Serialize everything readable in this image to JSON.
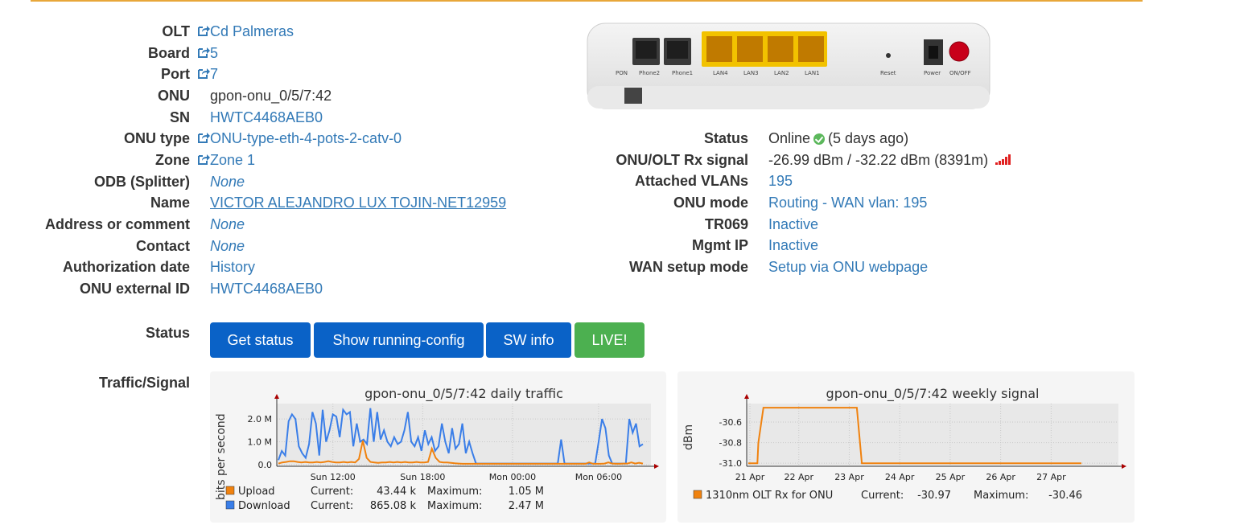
{
  "onu_details": [
    {
      "label": "OLT",
      "value": "Cd Palmeras",
      "link_icon": true,
      "style": "link"
    },
    {
      "label": "Board",
      "value": "5",
      "link_icon": true,
      "style": "link"
    },
    {
      "label": "Port",
      "value": "7",
      "link_icon": true,
      "style": "link"
    },
    {
      "label": "ONU",
      "value": "gpon-onu_0/5/7:42",
      "link_icon": false,
      "style": "plain"
    },
    {
      "label": "SN",
      "value": "HWTC4468AEB0",
      "link_icon": false,
      "style": "link"
    },
    {
      "label": "ONU type",
      "value": "ONU-type-eth-4-pots-2-catv-0",
      "link_icon": true,
      "style": "link"
    },
    {
      "label": "Zone",
      "value": "Zone 1",
      "link_icon": true,
      "style": "link"
    },
    {
      "label": "ODB (Splitter)",
      "value": "None",
      "link_icon": false,
      "style": "italic"
    },
    {
      "label": "Name",
      "value": "VICTOR ALEJANDRO LUX TOJIN-NET12959",
      "link_icon": false,
      "style": "underline"
    },
    {
      "label": "Address or comment",
      "value": "None",
      "link_icon": false,
      "style": "italic"
    },
    {
      "label": "Contact",
      "value": "None",
      "link_icon": false,
      "style": "italic"
    },
    {
      "label": "Authorization date",
      "value": "History",
      "link_icon": false,
      "style": "link"
    },
    {
      "label": "ONU external ID",
      "value": "HWTC4468AEB0",
      "link_icon": false,
      "style": "link"
    }
  ],
  "device_image": {
    "ports": [
      "PON",
      "Phone2",
      "Phone1",
      "LAN4",
      "LAN3",
      "LAN2",
      "LAN1",
      "Reset",
      "Power",
      "ON/OFF"
    ]
  },
  "onu_status": {
    "status_label": "Status",
    "status_value": "Online",
    "status_suffix": "(5 days ago)",
    "rx_label": "ONU/OLT Rx signal",
    "rx_value": "-26.99 dBm / -32.22 dBm (8391m)",
    "vlans_label": "Attached VLANs",
    "vlans_value": "195",
    "mode_label": "ONU mode",
    "mode_value": "Routing - WAN vlan: 195",
    "tr069_label": "TR069",
    "tr069_value": "Inactive",
    "mgmt_label": "Mgmt IP",
    "mgmt_value": "Inactive",
    "wan_label": "WAN setup mode",
    "wan_value": "Setup via ONU webpage"
  },
  "actions": {
    "section_label": "Status",
    "get_status": "Get status",
    "show_running_config": "Show running-config",
    "sw_info": "SW info",
    "live": "LIVE!"
  },
  "graphs": {
    "section_label": "Traffic/Signal"
  },
  "colors": {
    "link": "#337ab7",
    "primary_button": "#0a62c7",
    "live_button": "#4cb050",
    "upload": "#f0820f",
    "download": "#3a7ee8",
    "accent_line": "#e8a73a"
  },
  "chart_data": [
    {
      "type": "line",
      "title": "gpon-onu_0/5/7:42 daily traffic",
      "ylabel": "bits per second",
      "yticks": [
        "2.0 M",
        "1.0 M",
        "0.0"
      ],
      "xticks": [
        "Sun 12:00",
        "Sun 18:00",
        "Mon 00:00",
        "Mon 06:00"
      ],
      "ylim": [
        0,
        2.6
      ],
      "grid": true,
      "series": [
        {
          "name": "Upload",
          "color": "#f0820f",
          "values": [
            0.05,
            0.1,
            0.12,
            0.15,
            0.15,
            0.12,
            0.1,
            0.12,
            0.1,
            0.1,
            0.12,
            0.1,
            0.12,
            0.15,
            0.12,
            0.1,
            0.1,
            0.12,
            0.1,
            0.12,
            0.1,
            0.25,
            1.05,
            0.3,
            0.12,
            0.1,
            0.08,
            0.1,
            0.1,
            0.12,
            0.1,
            0.12,
            0.1,
            0.12,
            0.1,
            0.1,
            0.12,
            0.1,
            0.1,
            0.12,
            0.7,
            0.3,
            0.12,
            0.1,
            0.1,
            0.08,
            0.06,
            0.05,
            0.04,
            0.04,
            0.04,
            0.04,
            0.04,
            0.04,
            0.04,
            0.04,
            0.04,
            0.04,
            0.04,
            0.04,
            0.04,
            0.04,
            0.04,
            0.04,
            0.04,
            0.04,
            0.04,
            0.04,
            0.04,
            0.04,
            0.04,
            0.04,
            0.04,
            0.04,
            0.04,
            0.04,
            0.04,
            0.04,
            0.04,
            0.04,
            0.04,
            0.1,
            0.04,
            0.04,
            0.04,
            0.05,
            0.1,
            0.05,
            0.04,
            0.04,
            0.05,
            0.05,
            0.1,
            0.05,
            0.08,
            0.05
          ],
          "current": "43.44 k",
          "maximum": "1.05 M"
        },
        {
          "name": "Download",
          "color": "#3a7ee8",
          "values": [
            0.2,
            0.6,
            0.4,
            1.9,
            2.2,
            2.0,
            0.8,
            0.5,
            0.3,
            0.9,
            2.3,
            1.8,
            0.4,
            2.4,
            1.0,
            1.5,
            2.2,
            2.1,
            1.2,
            2.4,
            2.2,
            2.3,
            0.8,
            1.8,
            1.0,
            1.1,
            0.9,
            2.47,
            1.0,
            2.3,
            1.1,
            1.5,
            1.0,
            0.8,
            1.2,
            0.9,
            1.0,
            1.5,
            2.3,
            1.0,
            0.8,
            1.2,
            0.6,
            1.5,
            0.9,
            1.2,
            0.6,
            0.8,
            1.8,
            1.0,
            0.5,
            1.6,
            0.7,
            0.9,
            1.8,
            0.5,
            1.0,
            0.5,
            0.05,
            0.05,
            0.05,
            0.05,
            0.05,
            0.05,
            0.05,
            0.05,
            0.05,
            0.05,
            0.05,
            0.05,
            0.05,
            0.05,
            0.05,
            0.05,
            0.05,
            0.05,
            0.05,
            0.05,
            0.05,
            0.05,
            0.05,
            0.05,
            0.05,
            1.1,
            0.05,
            0.05,
            0.05,
            0.05,
            0.05,
            0.05,
            0.05,
            0.05,
            0.05,
            0.05,
            1.0,
            2.0,
            1.6,
            0.4,
            0.05,
            0.05,
            0.05,
            0.05,
            0.05,
            2.0,
            1.4,
            1.8,
            0.8,
            0.9
          ],
          "current": "865.08 k",
          "maximum": "2.47 M"
        }
      ],
      "legend_placement": "bottom"
    },
    {
      "type": "line",
      "title": "gpon-onu_0/5/7:42 weekly signal",
      "ylabel": "dBm",
      "yticks": [
        "-30.6",
        "-30.8",
        "-31.0"
      ],
      "xticks": [
        "21 Apr",
        "22 Apr",
        "23 Apr",
        "24 Apr",
        "25 Apr",
        "26 Apr",
        "27 Apr"
      ],
      "ylim": [
        -31.03,
        -30.42
      ],
      "grid": true,
      "series": [
        {
          "name": "1310nm OLT Rx for ONU",
          "color": "#f0820f",
          "x": [
            0,
            0.18,
            0.2,
            0.3,
            2.15,
            2.25,
            3.3,
            4.4,
            5.5,
            6.6
          ],
          "values": [
            -31.0,
            -31.0,
            -30.8,
            -30.46,
            -30.46,
            -31.0,
            -31.0,
            -31.0,
            -31.0,
            -31.0
          ],
          "current": "-30.97",
          "maximum": "-30.46"
        }
      ],
      "legend_placement": "bottom"
    }
  ]
}
